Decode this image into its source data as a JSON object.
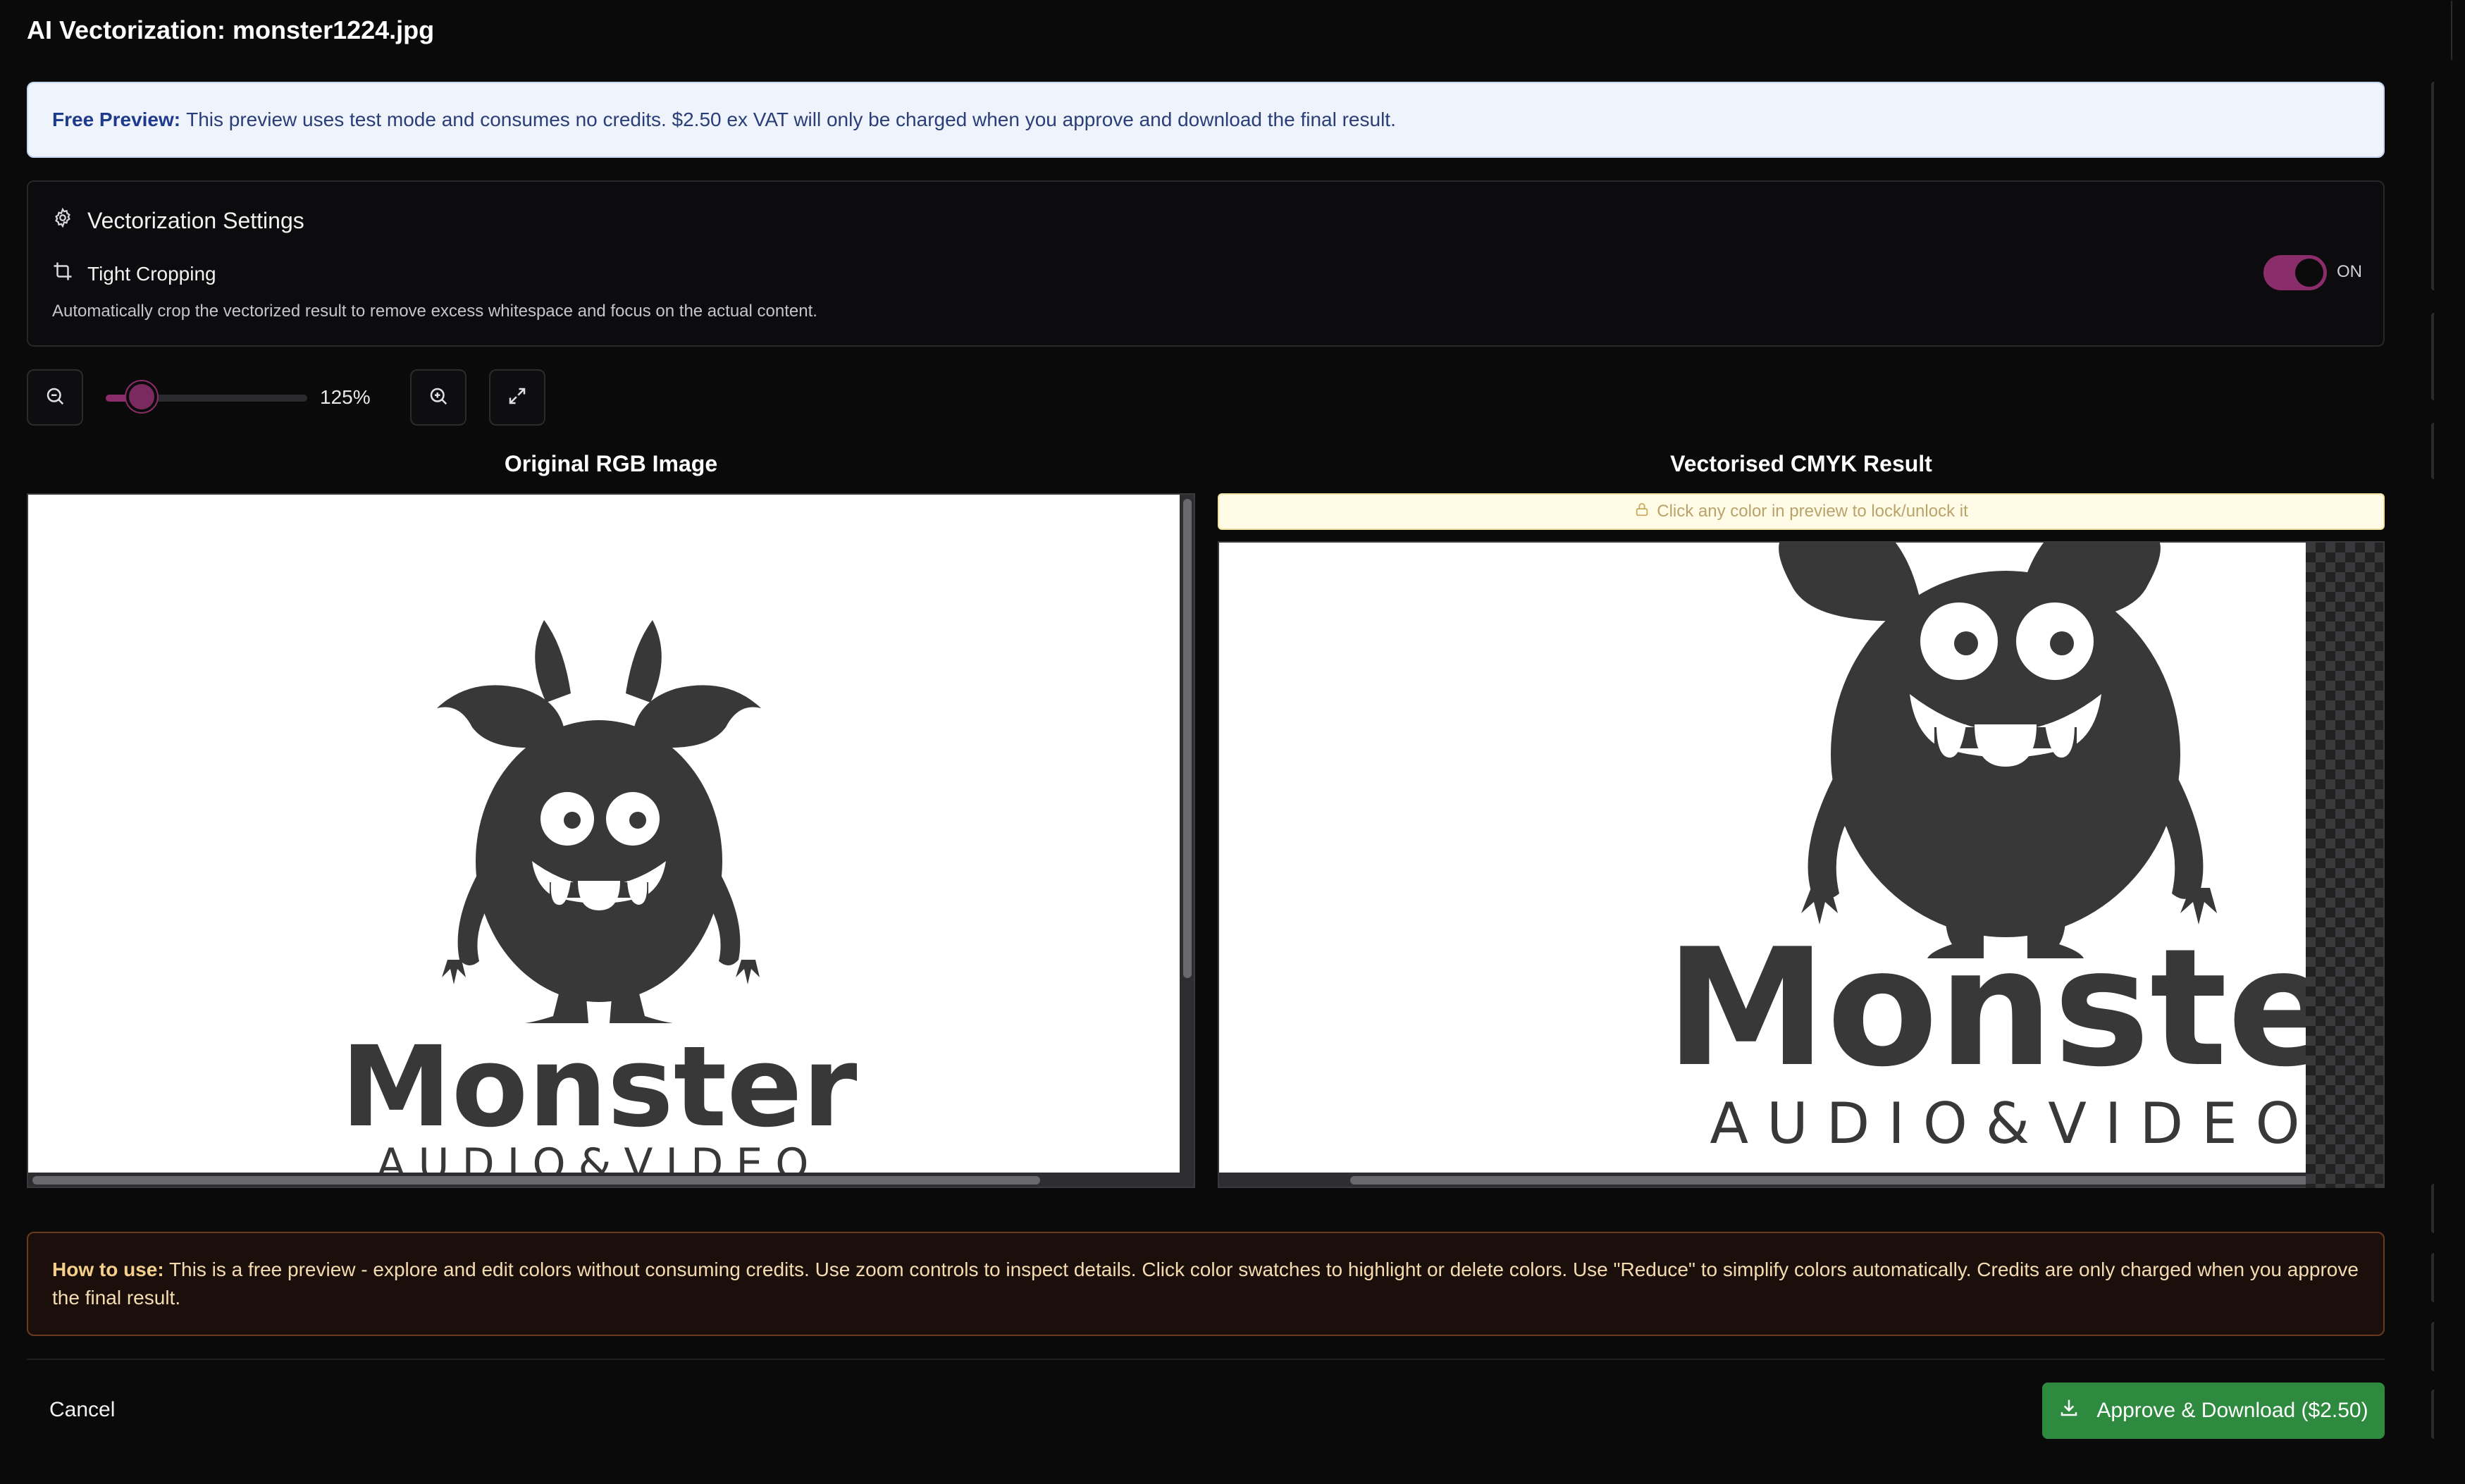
{
  "header": {
    "title": "AI Vectorization: monster1224.jpg"
  },
  "banner": {
    "label": "Free Preview:",
    "text": "This preview uses test mode and consumes no credits. $2.50 ex VAT will only be charged when you approve and download the final result."
  },
  "settings": {
    "title": "Vectorization Settings",
    "tight_cropping": {
      "label": "Tight Cropping",
      "description": "Automatically crop the vectorized result to remove excess whitespace and focus on the actual content.",
      "state": "ON",
      "enabled": true
    }
  },
  "zoom": {
    "value_label": "125%",
    "level_fraction": 0.18
  },
  "panes": {
    "original_title": "Original RGB Image",
    "result_title": "Vectorised CMYK Result",
    "lock_hint": "Click any color in preview to lock/unlock it"
  },
  "logo": {
    "wordmark": "Monster",
    "tagline": "AUDIO&VIDEO",
    "result_wordmark": "Monste",
    "color": "#383838"
  },
  "howto": {
    "label": "How to use:",
    "text": "This is a free preview - explore and edit colors without consuming credits. Use zoom controls to inspect details. Click color swatches to highlight or delete colors. Use \"Reduce\" to simplify colors automatically. Credits are only charged when you approve the final result."
  },
  "footer": {
    "cancel_label": "Cancel",
    "approve_label": "Approve & Download ($2.50)"
  },
  "colors": {
    "accent": "#8a2d6a",
    "approve": "#2d8a3e",
    "banner_bg": "#eef3fc",
    "howto_border": "#6b3a1e"
  }
}
